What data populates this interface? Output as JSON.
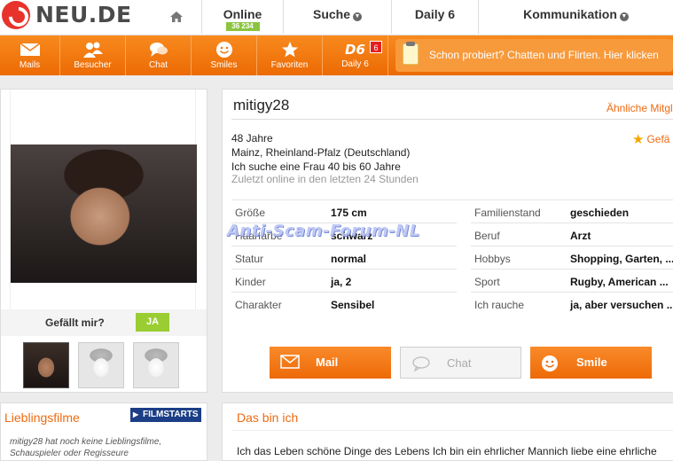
{
  "header": {
    "logo_text": "NEU.DE",
    "nav": {
      "online_label": "Online",
      "online_count": "36 234",
      "suche_label": "Suche",
      "daily_label": "Daily 6",
      "komm_label": "Kommunikation"
    }
  },
  "toolbar": {
    "items": [
      {
        "label": "Mails",
        "icon": "envelope-icon"
      },
      {
        "label": "Besucher",
        "icon": "visitors-icon"
      },
      {
        "label": "Chat",
        "icon": "chat-bubble-icon"
      },
      {
        "label": "Smiles",
        "icon": "smiley-icon"
      },
      {
        "label": "Favoriten",
        "icon": "star-icon"
      },
      {
        "label": "Daily 6",
        "icon": "d6-icon",
        "icon_text": "D6",
        "badge": "6"
      }
    ],
    "promo_text": "Schon probiert? Chatten und Flirten. Hier klicken"
  },
  "left": {
    "like_label": "Gefällt mir?",
    "like_button": "JA",
    "films_title": "Lieblingsfilme",
    "films_brand": "FILMSTARTS",
    "films_text": "mitigy28 hat noch keine Lieblingsfilme, Schauspieler oder Regisseure"
  },
  "profile": {
    "username": "mitigy28",
    "similar_link": "Ähnliche Mitgl",
    "favorite_link": "Gefä",
    "age": "48 Jahre",
    "location": "Mainz, Rheinland-Pfalz (Deutschland)",
    "seeking": "Ich suche eine Frau 40 bis 60 Jahre",
    "last_online": "Zuletzt online in den letzten 24 Stunden",
    "attributes_left": [
      {
        "key": "Größe",
        "value": "175 cm"
      },
      {
        "key": "Haarfarbe",
        "value": "schwarz"
      },
      {
        "key": "Statur",
        "value": "normal"
      },
      {
        "key": "Kinder",
        "value": "ja, 2"
      },
      {
        "key": "Charakter",
        "value": "Sensibel"
      }
    ],
    "attributes_right": [
      {
        "key": "Familienstand",
        "value": "geschieden"
      },
      {
        "key": "Beruf",
        "value": "Arzt"
      },
      {
        "key": "Hobbys",
        "value": "Shopping, Garten, ..."
      },
      {
        "key": "Sport",
        "value": "Rugby, American ..."
      },
      {
        "key": "Ich rauche",
        "value": "ja, aber versuchen ..."
      }
    ],
    "buttons": {
      "mail": "Mail",
      "chat": "Chat",
      "smile": "Smile"
    }
  },
  "about": {
    "title": "Das bin ich",
    "text": "Ich das Leben schöne Dinge des Lebens Ich bin ein ehrlicher Mannich liebe eine ehrliche"
  },
  "watermark": "Anti-Scam-Forum-NL",
  "colors": {
    "accent": "#ee6a10",
    "like_green": "#9acd32",
    "online_badge": "#8bc53f"
  }
}
